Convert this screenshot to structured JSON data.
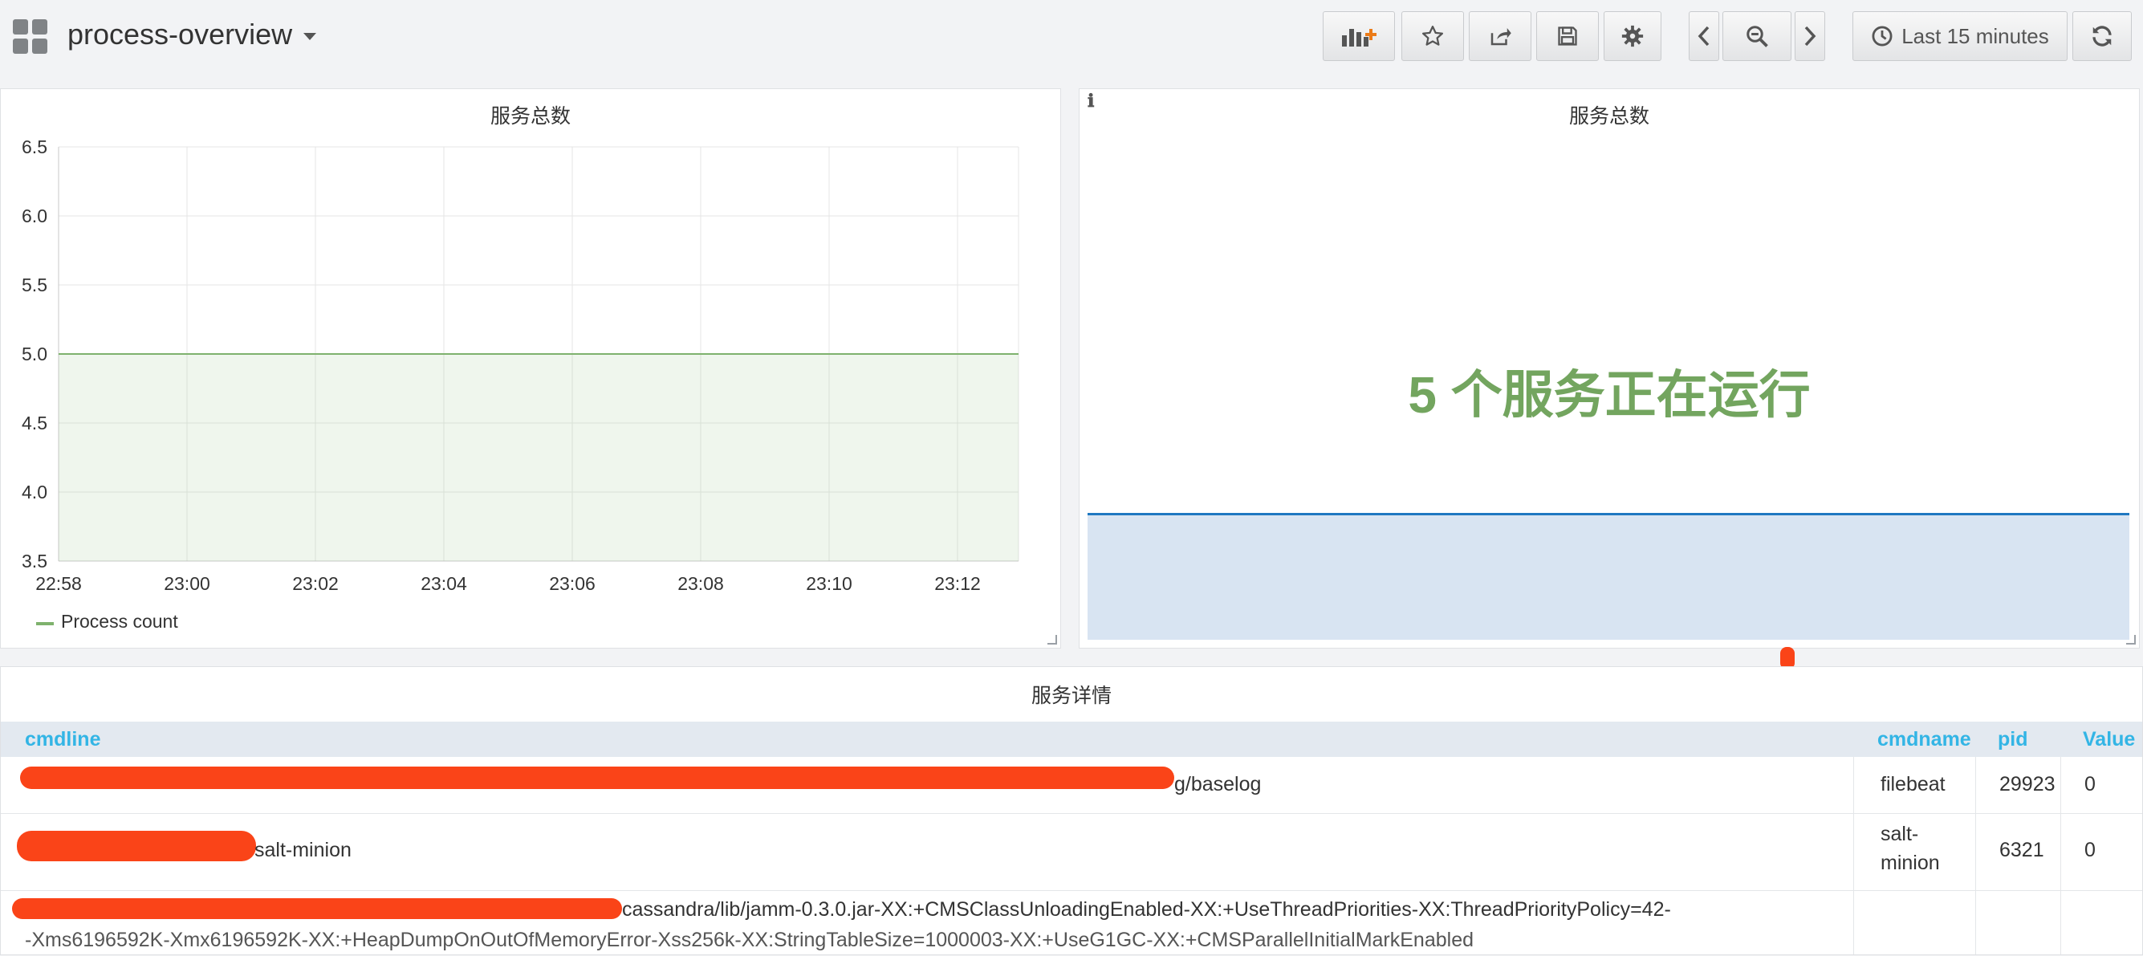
{
  "navbar": {
    "dashboard_title": "process-overview",
    "time_range_label": "Last 15 minutes",
    "icons": {
      "dashboards": "grid-icon",
      "add_panel": "bar-chart-plus-icon",
      "star": "star-icon",
      "share": "share-icon",
      "save": "save-icon",
      "settings": "gear-icon",
      "prev": "chevron-left-icon",
      "zoom_out": "zoom-out-icon",
      "next": "chevron-right-icon",
      "clock": "clock-icon",
      "refresh": "refresh-icon"
    }
  },
  "graph_panel": {
    "title": "服务总数",
    "legend": {
      "label": "Process count",
      "color": "#7eb26d"
    },
    "chart_data": {
      "type": "area",
      "title": "服务总数",
      "x": [
        "22:58",
        "23:00",
        "23:02",
        "23:04",
        "23:06",
        "23:08",
        "23:10",
        "23:12"
      ],
      "x_ticks": [
        "22:58",
        "23:00",
        "23:02",
        "23:04",
        "23:06",
        "23:08",
        "23:10",
        "23:12"
      ],
      "y_ticks": [
        "6.5",
        "6.0",
        "5.5",
        "5.0",
        "4.5",
        "4.0",
        "3.5"
      ],
      "ylim": [
        3.5,
        6.5
      ],
      "series": [
        {
          "name": "Process count",
          "values": [
            5,
            5,
            5,
            5,
            5,
            5,
            5,
            5
          ],
          "color": "#7eb26d"
        }
      ],
      "grid": true,
      "legend_position": "bottom-left"
    }
  },
  "stat_panel": {
    "title": "服务总数",
    "info_icon": "ℹ",
    "value_text": "5 个服务正在运行",
    "value_color": "#73a55f",
    "sparkline_color": "#1f78c1",
    "sparkline_fill": "#d8e4f2"
  },
  "table_panel": {
    "title": "服务详情",
    "columns": [
      "cmdline",
      "cmdname",
      "pid",
      "Value"
    ],
    "rows": [
      {
        "cmdline_visible": "g/baselog",
        "cmdname": "filebeat",
        "pid": "29923",
        "value": "0"
      },
      {
        "cmdline_visible": "salt-minion",
        "cmdname_line1": "salt-",
        "cmdname_line2": "minion",
        "pid": "6321",
        "value": "0"
      },
      {
        "cmdline_visible": "cassandra/lib/jamm-0.3.0.jar-XX:+CMSClassUnloadingEnabled-XX:+UseThreadPriorities-XX:ThreadPriorityPolicy=42-",
        "cmdline_line2": "-Xms6196592K-Xmx6196592K-XX:+HeapDumpOnOutOfMemoryError-Xss256k-XX:StringTableSize=1000003-XX:+UseG1GC-XX:+CMSParallelInitialMarkEnabled"
      }
    ],
    "redaction_color": "#fa4418"
  }
}
